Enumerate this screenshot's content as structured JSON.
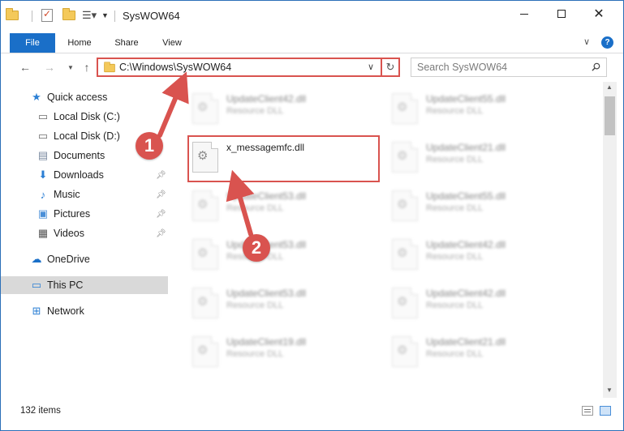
{
  "window": {
    "title": "SysWOW64",
    "accent_color": "#1a6fc8",
    "close_glyph": "✕",
    "help_glyph": "?"
  },
  "ribbon": {
    "tabs": [
      "File",
      "Home",
      "Share",
      "View"
    ]
  },
  "address_bar": {
    "path": "C:\\Windows\\SysWOW64",
    "highlight_color": "#d9534f"
  },
  "search": {
    "placeholder": "Search SysWOW64"
  },
  "sidebar": {
    "items": [
      {
        "label": "Quick access",
        "icon": "star-icon"
      },
      {
        "label": "Local Disk (C:)",
        "icon": "drive-icon"
      },
      {
        "label": "Local Disk (D:)",
        "icon": "drive-icon"
      },
      {
        "label": "Documents",
        "icon": "documents-icon"
      },
      {
        "label": "Downloads",
        "icon": "download-icon",
        "pinned": true
      },
      {
        "label": "Music",
        "icon": "music-icon",
        "pinned": true
      },
      {
        "label": "Pictures",
        "icon": "pictures-icon",
        "pinned": true
      },
      {
        "label": "Videos",
        "icon": "videos-icon",
        "pinned": true
      },
      {
        "label": "OneDrive",
        "icon": "cloud-icon"
      },
      {
        "label": "This PC",
        "icon": "computer-icon",
        "selected": true
      },
      {
        "label": "Network",
        "icon": "network-icon"
      }
    ]
  },
  "files": {
    "highlighted": {
      "name": "x_messagemfc.dll"
    },
    "background": [
      {
        "name": "UpdateClient42.dll",
        "type": "Resource DLL"
      },
      {
        "name": "UpdateClient55.dll",
        "type": "Resource DLL"
      },
      {
        "name": "UpdateClient21.dll",
        "type": "Resource DLL"
      },
      {
        "name": "UpdateClient53.dll",
        "type": "Resource DLL"
      },
      {
        "name": "UpdateClient55.dll",
        "type": "Resource DLL"
      },
      {
        "name": "UpdateClient53.dll",
        "type": "Resource DLL"
      },
      {
        "name": "UpdateClient42.dll",
        "type": "Resource DLL"
      },
      {
        "name": "UpdateClient53.dll",
        "type": "Resource DLL"
      },
      {
        "name": "UpdateClient42.dll",
        "type": "Resource DLL"
      },
      {
        "name": "UpdateClient19.dll",
        "type": "Resource DLL"
      },
      {
        "name": "UpdateClient21.dll",
        "type": "Resource DLL"
      }
    ]
  },
  "status": {
    "item_count": "132 items"
  },
  "annotations": {
    "step1": "1",
    "step2": "2"
  }
}
